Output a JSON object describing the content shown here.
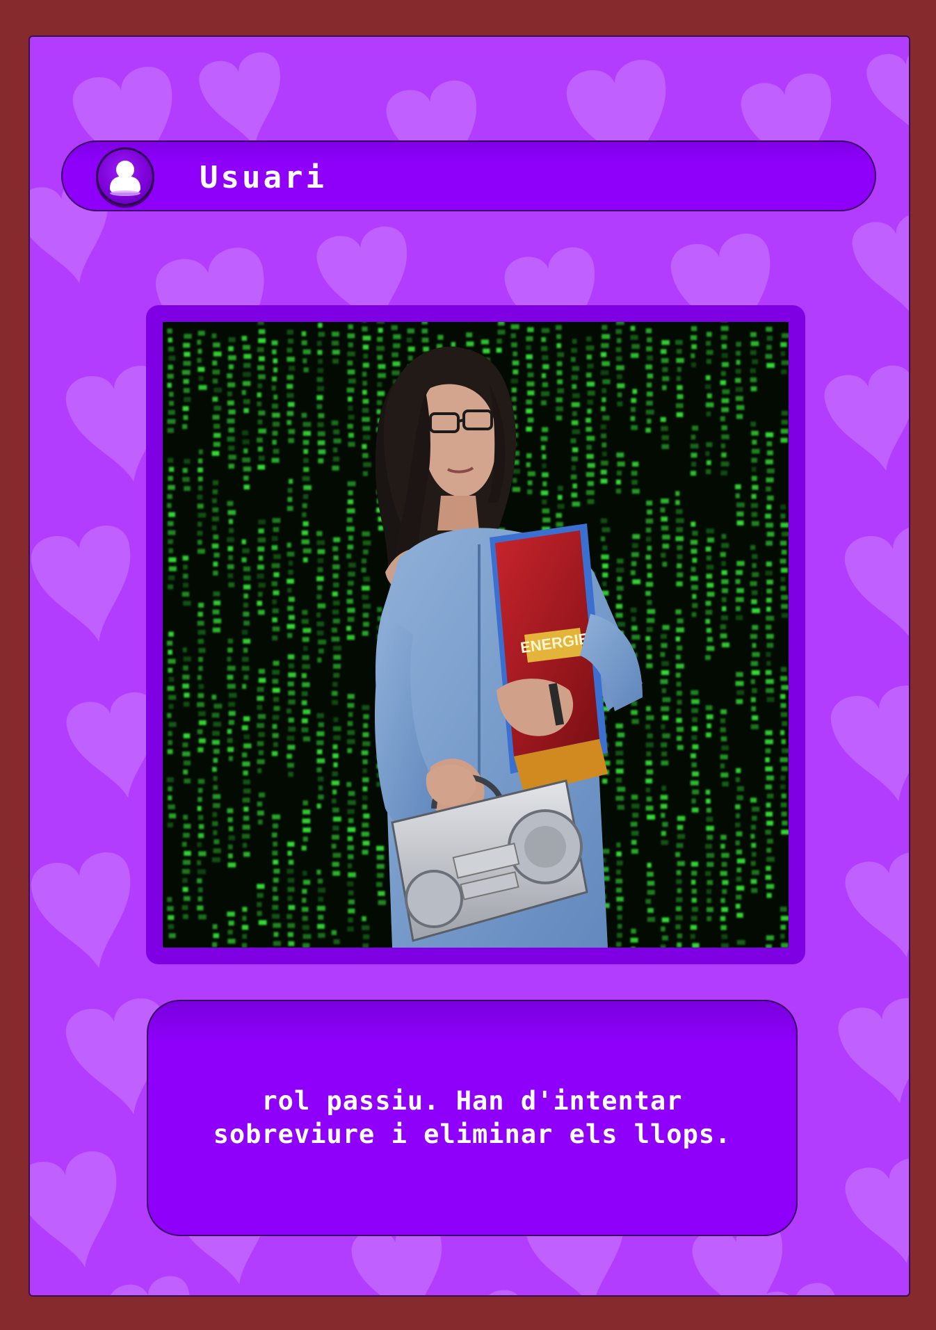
{
  "card": {
    "title": "Usuari",
    "avatar_icon": "user-silhouette-icon",
    "photo_description_icon": "character-portrait",
    "description_line1": "rol passiu. Han d'intentar",
    "description_line2": "sobreviure i eliminar els llops."
  },
  "colors": {
    "page_background": "#862a2e",
    "card_background": "#b23dff",
    "panel_purple": "#8e00fa",
    "frame_purple": "#7f00e3",
    "matrix_green": "#38e83a"
  }
}
